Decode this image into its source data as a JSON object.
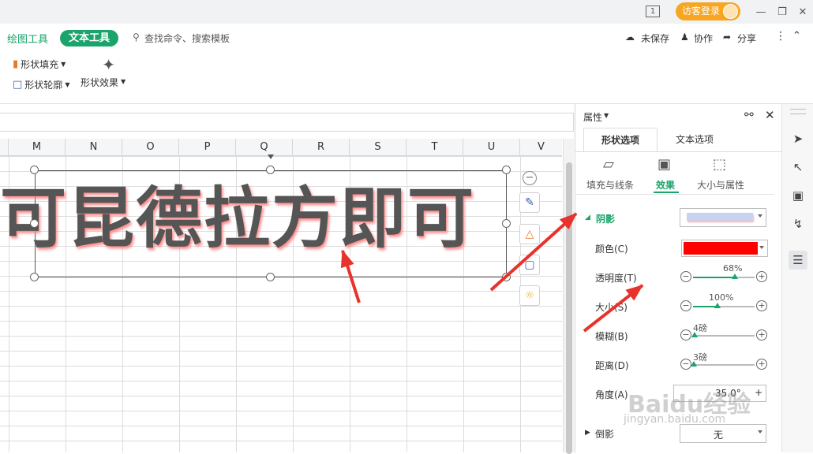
{
  "titlebar": {
    "page_indicator": "1",
    "login_label": "访客登录"
  },
  "tabs": {
    "draw_tools": "绘图工具",
    "text_tools": "文本工具",
    "search_placeholder": "查找命令、搜索模板",
    "unsaved": "未保存",
    "collab": "协作",
    "share": "分享"
  },
  "ribbon": {
    "shape_fill": "形状填充",
    "shape_outline": "形状轮廓",
    "shape_effect": "形状效果"
  },
  "sheet": {
    "columns": [
      "M",
      "N",
      "O",
      "P",
      "Q",
      "R",
      "S",
      "T",
      "U",
      "V"
    ],
    "textbox_text": "可昆德拉方即可"
  },
  "panel": {
    "title": "属性",
    "tabs": [
      "形状选项",
      "文本选项"
    ],
    "subtabs": [
      "填充与线条",
      "效果",
      "大小与属性"
    ],
    "shadow_section": "阴影",
    "color_label": "颜色(C)",
    "transparency_label": "透明度(T)",
    "transparency_value": "68%",
    "transparency_fraction": 0.68,
    "size_label": "大小(S)",
    "size_value": "100%",
    "size_fraction": 0.4,
    "blur_label": "模糊(B)",
    "blur_value": "4磅",
    "blur_fraction": 0.02,
    "distance_label": "距离(D)",
    "distance_value": "3磅",
    "distance_fraction": 0.01,
    "angle_label": "角度(A)",
    "angle_value": "35.0°",
    "reflection_section": "倒影",
    "reflection_value": "无",
    "shadow_color": "#ff0000"
  },
  "watermark": {
    "brand": "Baidu经验",
    "url": "jingyan.baidu.com"
  },
  "colors": {
    "accent_green": "#1aa36a",
    "annotation_red": "#e8322c",
    "login_orange": "#f6a623"
  }
}
